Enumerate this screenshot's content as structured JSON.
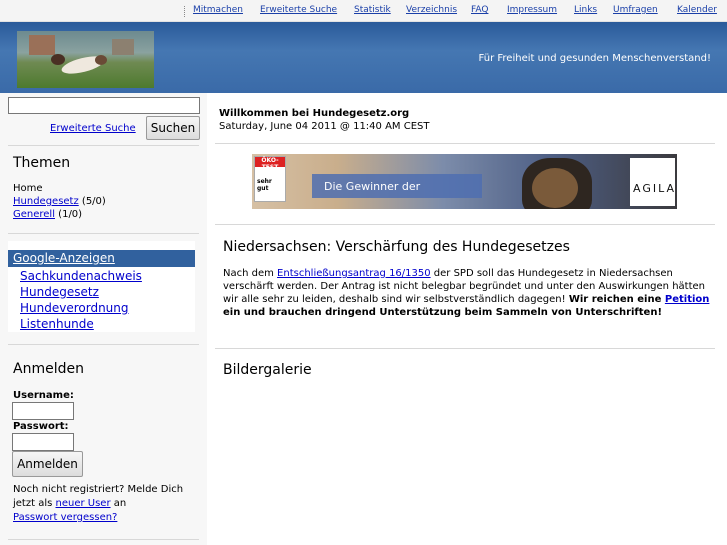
{
  "nav": {
    "links": [
      "Mitmachen",
      "Erweiterte Suche",
      "Statistik",
      "Verzeichnis",
      "FAQ",
      "Impressum",
      "Links",
      "Umfragen",
      "Kalender"
    ]
  },
  "header": {
    "slogan": "Für Freiheit und gesunden Menschenverstand!"
  },
  "search": {
    "value": "",
    "advanced_label": "Erweiterte Suche",
    "button_label": "Suchen"
  },
  "themen": {
    "title": "Themen",
    "home": "Home",
    "items": [
      {
        "label": "Hundegesetz",
        "count": " (5/0)"
      },
      {
        "label": "Generell",
        "count": " (1/0)"
      }
    ]
  },
  "ads": {
    "title": "Google-Anzeigen",
    "links": [
      "Sachkundenachweis",
      "Hundegesetz",
      "Hundeverordnung",
      "Listenhunde"
    ]
  },
  "login": {
    "title": "Anmelden",
    "username_label": "Username:",
    "password_label": "Passwort:",
    "button_label": "Anmelden",
    "register_text_1": "Noch nicht registriert? Melde Dich jetzt als ",
    "register_link": "neuer User",
    "register_text_2": " an",
    "forgot_link": "Passwort vergessen?"
  },
  "welcome": {
    "title": "Willkommen bei Hundegesetz.org",
    "date": "Saturday, June 04 2011 @ 11:40 AM CEST"
  },
  "banner": {
    "seal_top": "ÖKO-TEST",
    "seal_grade": "sehr gut",
    "text": "Die Gewinner der",
    "brand": "AGILA"
  },
  "article": {
    "title": "Niedersachsen: Verschärfung des Hundegesetzes",
    "p1": "Nach dem ",
    "link1": "Entschließungsantrag 16/1350",
    "p2": " der SPD soll das Hundegesetz in Niedersachsen verschärft werden. Der Antrag ist nicht belegbar begründet und unter den Auswirkungen hätten wir alle sehr zu leiden, deshalb sind wir selbstverständlich dagegen! ",
    "bold1": "Wir reichen eine ",
    "link2": "Petition",
    "bold2": " ein und brauchen dringend Unterstützung beim Sammeln von Unterschriften!"
  },
  "gallery": {
    "title": "Bildergalerie"
  }
}
